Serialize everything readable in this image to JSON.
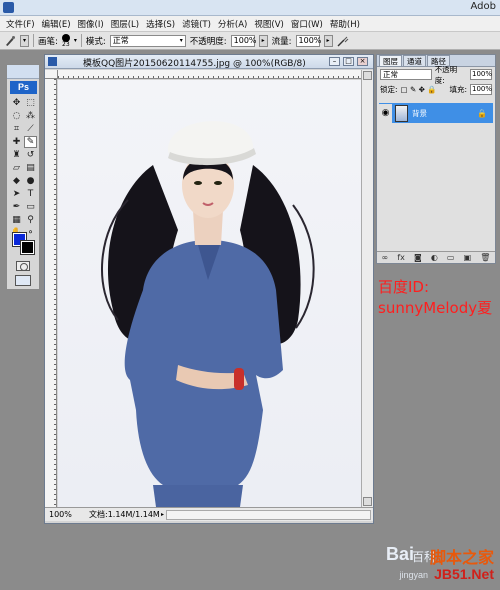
{
  "app": {
    "title": "Adob"
  },
  "menu": [
    "文件(F)",
    "编辑(E)",
    "图像(I)",
    "图层(L)",
    "选择(S)",
    "滤镜(T)",
    "分析(A)",
    "视图(V)",
    "窗口(W)",
    "帮助(H)"
  ],
  "options": {
    "brush_label": "画笔:",
    "brush_size": "23",
    "mode_label": "模式:",
    "mode_value": "正常",
    "opacity_label": "不透明度:",
    "opacity_value": "100%",
    "flow_label": "流量:",
    "flow_value": "100%"
  },
  "toolbox": {
    "logo": "Ps",
    "fg_color": "#0a28d8",
    "bg_color": "#000000"
  },
  "document": {
    "title": "模板QQ图片20150620114755.jpg @ 100%(RGB/8)",
    "zoom": "100%",
    "doc_size": "文档:1.14M/1.14M"
  },
  "layers_panel": {
    "tabs": [
      "图层",
      "通道",
      "路径"
    ],
    "blend_mode": "正常",
    "opacity_label": "不透明度:",
    "opacity_value": "100%",
    "lock_label": "锁定:",
    "fill_label": "填充:",
    "fill_value": "100%",
    "layer_name": "背景"
  },
  "annotation": {
    "line1": "百度ID:",
    "line2": "sunnyMelody夏"
  },
  "watermark": {
    "text1": "Bai",
    "text2": "百科",
    "text3": "脚本之家",
    "text4": "jingyan",
    "text5": "JB51.Net"
  }
}
